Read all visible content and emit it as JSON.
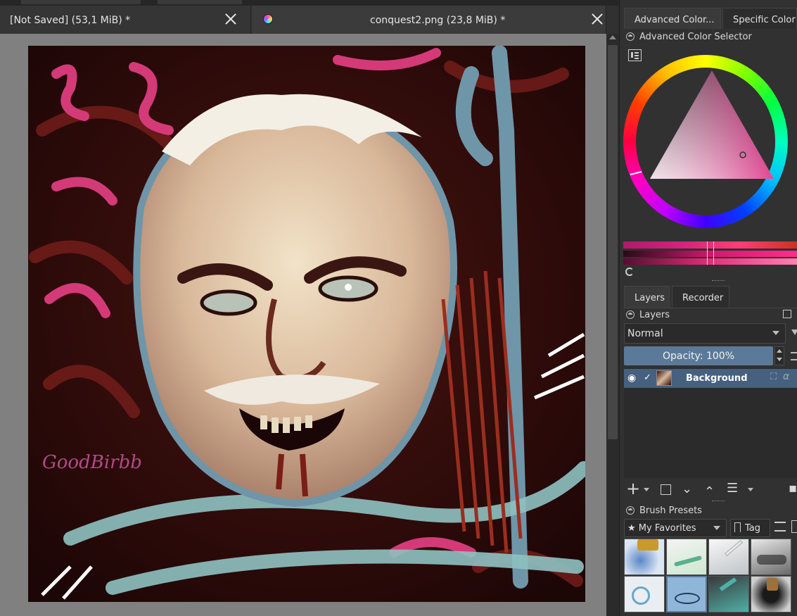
{
  "tabs": [
    {
      "label": "[Not Saved]   (53,1 MiB) *",
      "close_icon": "close-icon"
    },
    {
      "label": "conquest2.png (23,8 MiB) *",
      "close_icon": "close-icon",
      "icon": "krita-document-icon"
    }
  ],
  "artwork": {
    "signature": "GoodBirbb"
  },
  "color_docker": {
    "tabs": [
      "Advanced Color...",
      "Specific Color ..."
    ],
    "title": "Advanced Color Selector",
    "settings_icon": "list-settings-icon"
  },
  "layers_docker": {
    "tabs": [
      "Layers",
      "Recorder"
    ],
    "title": "Layers",
    "blend_mode": "Normal",
    "opacity_label": "Opacity:  100%",
    "layers": [
      {
        "name": "Background",
        "visible": true,
        "checked": true
      }
    ],
    "toolbar_icons": [
      "add-icon",
      "duplicate-icon",
      "move-down-icon",
      "move-up-icon",
      "properties-icon",
      "delete-icon"
    ]
  },
  "brush_docker": {
    "title": "Brush Presets",
    "tag_filter": "My Favorites",
    "tag_button": "Tag",
    "star": "★"
  },
  "colors": {
    "accent": "#5b7a99",
    "selection": "#46607e",
    "panel": "#313131",
    "canvas_bg": "#808080"
  }
}
